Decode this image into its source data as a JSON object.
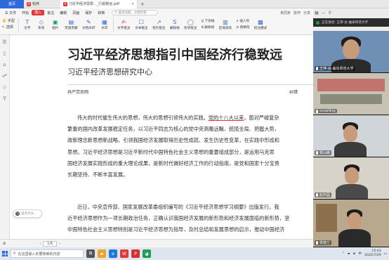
{
  "tabs": {
    "home": "首页",
    "draft": "稻壳",
    "document": "习近平经济思想..._行稳致远.pdf",
    "new_tab": "+"
  },
  "menu": {
    "file": "文件",
    "items": [
      "开始",
      "插入",
      "批注",
      "编辑",
      "页面",
      "保护",
      "转换"
    ],
    "active_index": 1,
    "search_placeholder": "查找功能、文档内容",
    "right_items": [
      "未同步",
      "协作",
      "分享"
    ]
  },
  "ribbon": {
    "hand": "手型",
    "select": "选择",
    "buttons": [
      {
        "label": "文字",
        "icon": "T"
      },
      {
        "label": "形状",
        "icon": "◇"
      },
      {
        "label": "图片",
        "icon": "▣"
      },
      {
        "label": "页眉页脚",
        "icon": "▤"
      },
      {
        "label": "文档水印",
        "icon": "✎"
      },
      {
        "label": "水印",
        "icon": "▦"
      },
      {
        "label": "文字批注",
        "icon": "✍"
      },
      {
        "label": "文本框注",
        "icon": "☐"
      },
      {
        "label": "指引批注",
        "icon": "↗"
      },
      {
        "label": "删除线",
        "icon": "S"
      },
      {
        "label": "形状批注",
        "icon": "◯"
      },
      {
        "label": "下划线",
        "icon": "U"
      },
      {
        "label": "区域高亮",
        "icon": "▥"
      },
      {
        "label": "批注模式",
        "icon": "▩"
      }
    ],
    "right_pair": [
      "下划线",
      "删除线"
    ],
    "right_pair2": [
      "插入符",
      "替换符"
    ]
  },
  "left_tools": [
    "☰",
    "▯",
    "⌂",
    "☍",
    "◇",
    "⚲"
  ],
  "document": {
    "title": "习近平经济思想指引中国经济行稳致远",
    "subtitle": "习近平经济思想研究中心",
    "source": "共产党员网",
    "marker": "纠错",
    "para1": [
      "伟大的时代催生伟大的思想，伟大的思想引领伟大的实践。党的十八大以来，面对严峻复杂",
      "繁重的国内改革发展稳定任务，以习近平同志为核心的党中央高瞻远瞩、统揽全局、把握大势，",
      "政新理念新思想新战略，引领我国经济发展取得历史性成就、发生历史性变革，在实践中形成和",
      "思想。习近平经济思想是习近平新时代中国特色社会主义思想的重要组成部分，是运用马克思",
      "国经济发展实践形成的重大理论成果，是新时代做好经济工作的行动指南，是党和国家十分宝贵",
      "长期坚持、不断丰富发展。"
    ],
    "para1_underline": "党的十八大以来",
    "para2": [
      "近日，中央宣传部、国家发展改革委组织编写的《习近平经济思想学习纲要》出版发行。我",
      "近平经济思想作为一项长期政治任务，正确认识我国经济发展的新形势和经济发展面临的新形势，坚",
      "中国特色社会主义思想特别是习近平经济思想为指导，及时总结和发展思想的启示，推动中国经济"
    ]
  },
  "chat_bubble": {
    "badge": "讯",
    "text": "说点什么..."
  },
  "statusbar": {
    "nav": "⊞",
    "page": "1/6",
    "zoom": "— ⊕ +"
  },
  "taskbar": {
    "search_text": "在这里输入你要搜索的内容",
    "apps": [
      {
        "name": "task-view",
        "glyph": "⧉",
        "color": "#555555"
      },
      {
        "name": "file-explorer",
        "glyph": "▰",
        "color": "#e8a72a"
      },
      {
        "name": "edge-browser",
        "glyph": "e",
        "color": "#1f7ad6"
      },
      {
        "name": "wps-writer",
        "glyph": "W",
        "color": "#e2383a"
      },
      {
        "name": "wps-pdf",
        "glyph": "P",
        "color": "#d23232"
      },
      {
        "name": "wechat",
        "glyph": "◕",
        "color": "#1b9e5a"
      }
    ],
    "ime": "中",
    "time": "15:43",
    "date": "2022/7/29"
  },
  "video_panel": {
    "meeting_title": "正在讲话: 王萍-女-曲阜师范大学",
    "participants": [
      {
        "name": "王萍-女-曲阜师范大学",
        "bg": "#6f8fb4",
        "shirt": "#2a2a2a"
      },
      {
        "name": "sunpiling",
        "bg": "#c7c2b4",
        "shirt": "#2e2e2e"
      },
      {
        "name": "贺山峰",
        "bg": "#cfd5d8",
        "shirt": "#3b3b3b"
      },
      {
        "name": "赵庆磊",
        "bg": "#d8d3c9",
        "shirt": "#4a4a4a"
      },
      {
        "name": "侯德兰",
        "bg": "#b7a88e",
        "shirt": "#2a2a2a"
      }
    ]
  },
  "colors": {
    "accent": "#e2383a",
    "brand_blue": "#2f6bd8"
  }
}
